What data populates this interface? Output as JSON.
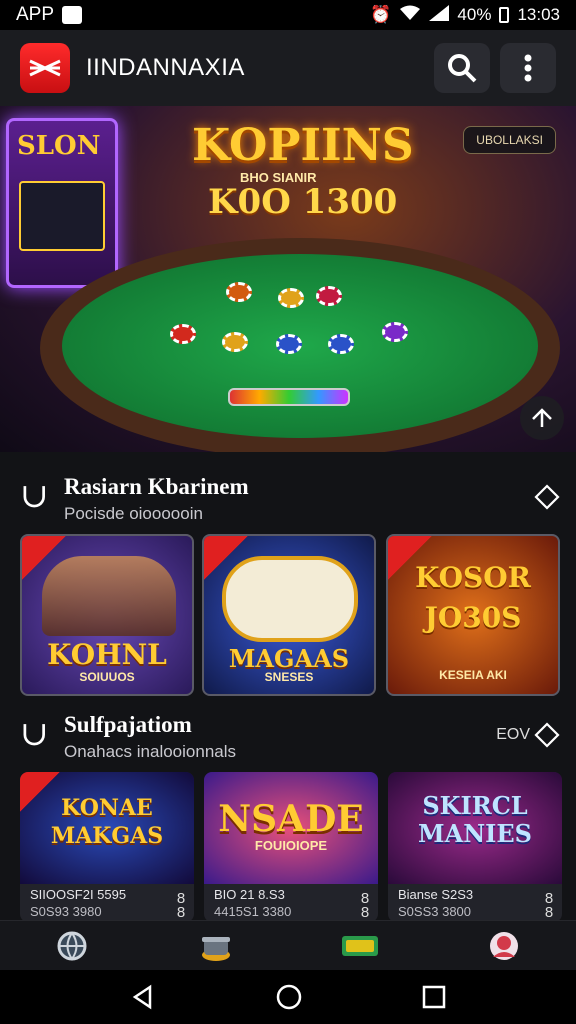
{
  "status_bar": {
    "left": "APP",
    "signal": "⁴ᴳ",
    "battery": "40%",
    "time": "13:03"
  },
  "app_bar": {
    "title": "IINDANNAXIA",
    "logo_icon": "brand-logo-icon",
    "search_icon": "search-icon",
    "menu_icon": "more-vertical-icon"
  },
  "hero": {
    "title": "KOPIINS",
    "subtitle": "BHO SIANIR",
    "amount": "K0O 1300",
    "badge": "UBOLLAKSI",
    "slot_label": "SLON",
    "action_icon": "share-icon"
  },
  "section1": {
    "title": "Rasiarn Kbarinem",
    "subtitle": "Pocisde oioooooin",
    "arrow": "chevron-icon",
    "cards": [
      {
        "title": "KOHNL",
        "sub": "SOIUUOS",
        "accent": "#3b2a8a"
      },
      {
        "title": "MAGAAS",
        "sub": "SNESES",
        "accent": "#1d2f7a"
      },
      {
        "title": "KOSOR JO30S",
        "sub": "KESEIA AKI",
        "accent": "#8a1f12"
      }
    ]
  },
  "section2": {
    "title": "Sulfpajatiom",
    "subtitle": "Onahacs inalooionnals",
    "more_label": "EOV",
    "cards": [
      {
        "title": "KONAE MAKGAS",
        "line1": "SIIOOSF2I 5595",
        "line2": "S0S93 3980",
        "num": "8 8"
      },
      {
        "title": "NSADE",
        "sub": "FOUIOIOPE",
        "line1": "BIO 21 8.S3",
        "line2": "4415S1 3380",
        "num": "8 8"
      },
      {
        "title": "SKIRCL MANIES",
        "line1": "Bianse S2S3",
        "line2": "S0SS3 3800",
        "num": "8 8"
      }
    ]
  },
  "bottom_nav": [
    {
      "icon": "globe-icon"
    },
    {
      "icon": "pot-icon"
    },
    {
      "icon": "cash-icon"
    },
    {
      "icon": "avatar-icon"
    }
  ],
  "system_nav": {
    "back": "back-icon",
    "home": "home-icon",
    "recents": "recents-icon"
  }
}
